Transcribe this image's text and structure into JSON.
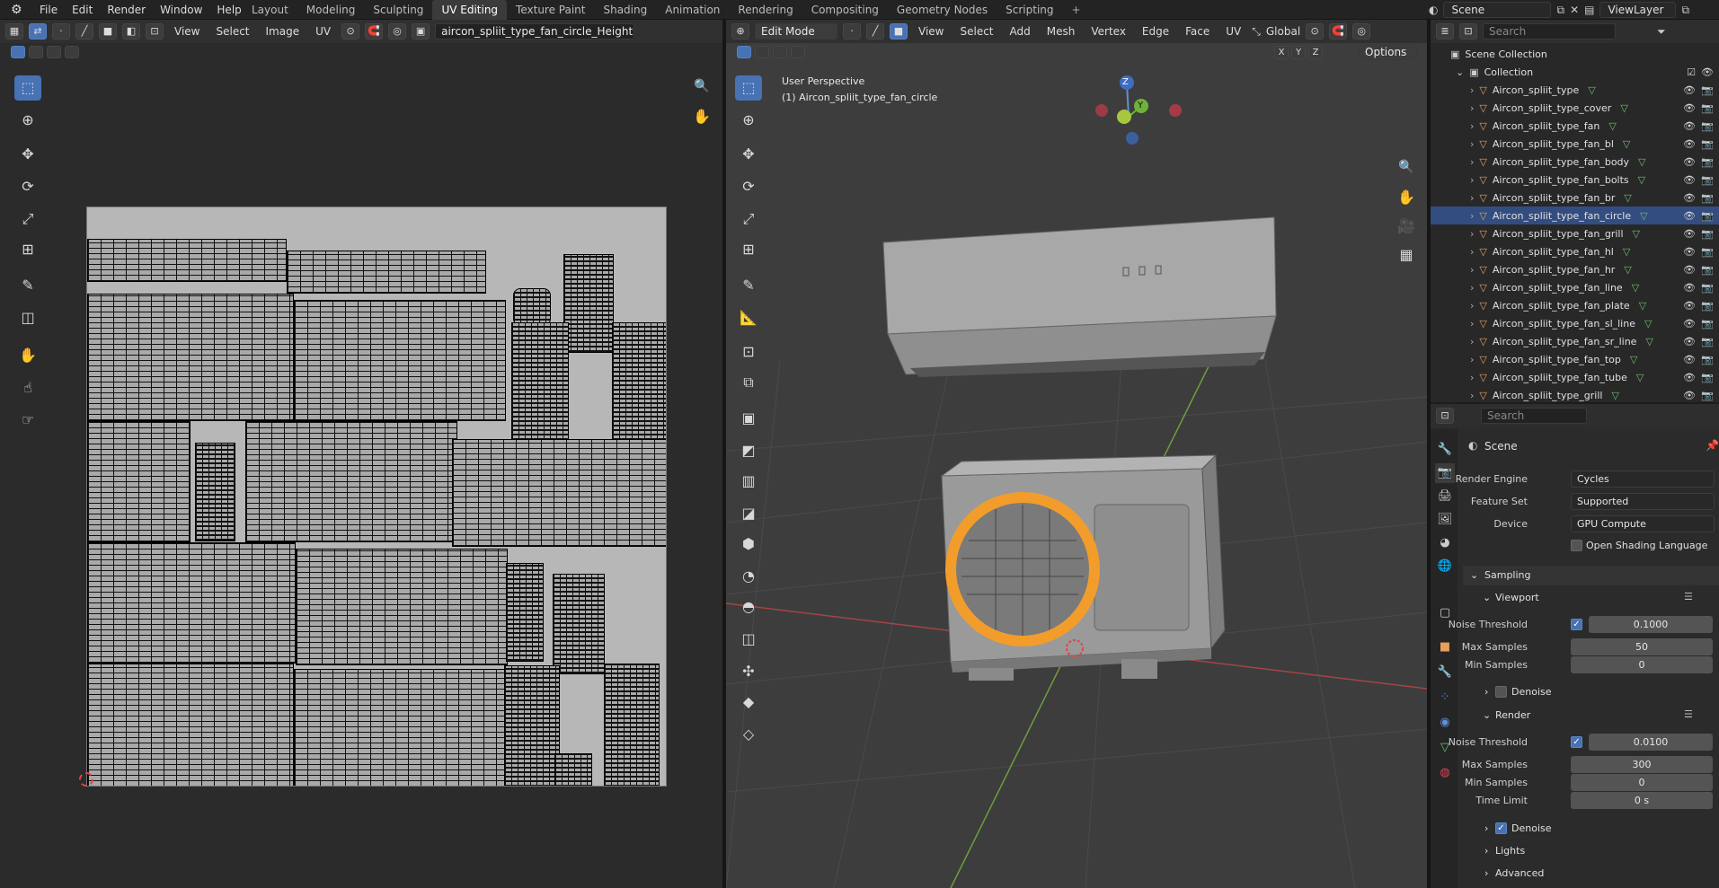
{
  "menu": [
    "File",
    "Edit",
    "Render",
    "Window",
    "Help"
  ],
  "workspaces": [
    "Layout",
    "Modeling",
    "Sculpting",
    "UV Editing",
    "Texture Paint",
    "Shading",
    "Animation",
    "Rendering",
    "Compositing",
    "Geometry Nodes",
    "Scripting"
  ],
  "active_workspace": "UV Editing",
  "scene_name": "Scene",
  "view_layer": "ViewLayer",
  "uv_editor": {
    "menus": [
      "View",
      "Select",
      "Image",
      "UV"
    ],
    "image_name": "aircon_spliit_type_fan_circle_Height.png"
  },
  "viewport": {
    "mode": "Edit Mode",
    "menus": [
      "View",
      "Select",
      "Add",
      "Mesh",
      "Vertex",
      "Edge",
      "Face",
      "UV"
    ],
    "orientation": "Global",
    "axes": [
      "X",
      "Y",
      "Z"
    ],
    "options_label": "Options",
    "overlay_title": "User Perspective",
    "overlay_object": "(1) Aircon_spliit_type_fan_circle",
    "gizmo_axes": [
      "Z",
      "Y"
    ]
  },
  "outliner": {
    "search_placeholder": "Search",
    "scene_collection": "Scene Collection",
    "collection": "Collection",
    "items": [
      "Aircon_spliit_type",
      "Aircon_spliit_type_cover",
      "Aircon_spliit_type_fan",
      "Aircon_spliit_type_fan_bl",
      "Aircon_spliit_type_fan_body",
      "Aircon_spliit_type_fan_bolts",
      "Aircon_spliit_type_fan_br",
      "Aircon_spliit_type_fan_circle",
      "Aircon_spliit_type_fan_grill",
      "Aircon_spliit_type_fan_hl",
      "Aircon_spliit_type_fan_hr",
      "Aircon_spliit_type_fan_line",
      "Aircon_spliit_type_fan_plate",
      "Aircon_spliit_type_fan_sl_line",
      "Aircon_spliit_type_fan_sr_line",
      "Aircon_spliit_type_fan_top",
      "Aircon_spliit_type_fan_tube",
      "Aircon_spliit_type_grill"
    ],
    "selected": "Aircon_spliit_type_fan_circle"
  },
  "properties": {
    "search_placeholder": "Search",
    "context": "Scene",
    "render_engine_label": "Render Engine",
    "render_engine": "Cycles",
    "feature_set_label": "Feature Set",
    "feature_set": "Supported",
    "device_label": "Device",
    "device": "GPU Compute",
    "osl_label": "Open Shading Language",
    "sampling": "Sampling",
    "viewport_section": "Viewport",
    "render_section": "Render",
    "noise_threshold_label": "Noise Threshold",
    "max_samples_label": "Max Samples",
    "min_samples_label": "Min Samples",
    "time_limit_label": "Time Limit",
    "denoise_label": "Denoise",
    "viewport_noise_threshold": "0.1000",
    "viewport_max_samples": "50",
    "viewport_min_samples": "0",
    "render_noise_threshold": "0.0100",
    "render_max_samples": "300",
    "render_min_samples": "0",
    "render_time_limit": "0 s",
    "lights": "Lights",
    "advanced": "Advanced"
  },
  "colors": {
    "accent": "#4772b3",
    "selection_orange": "#f29d2b",
    "object_icon": "#e9a05a"
  }
}
